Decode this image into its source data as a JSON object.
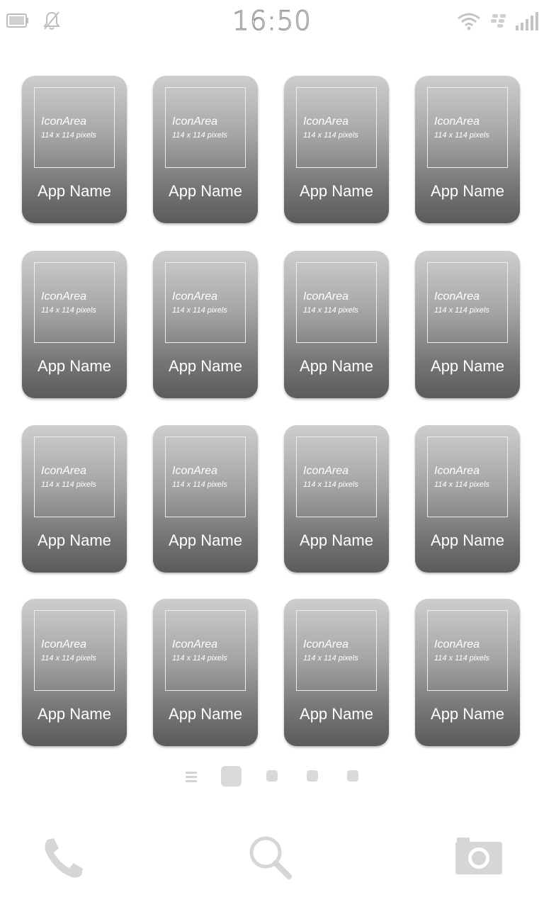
{
  "status_bar": {
    "time": "16:50",
    "icons": [
      "battery-icon",
      "notifications-off-icon",
      "wifi-icon",
      "bbm-icon",
      "signal-icon"
    ]
  },
  "apps": [
    {
      "icon_area_title": "IconArea",
      "icon_area_size": "114 x 114 pixels",
      "name": "App Name"
    },
    {
      "icon_area_title": "IconArea",
      "icon_area_size": "114 x 114 pixels",
      "name": "App Name"
    },
    {
      "icon_area_title": "IconArea",
      "icon_area_size": "114 x 114 pixels",
      "name": "App Name"
    },
    {
      "icon_area_title": "IconArea",
      "icon_area_size": "114 x 114 pixels",
      "name": "App Name"
    },
    {
      "icon_area_title": "IconArea",
      "icon_area_size": "114 x 114 pixels",
      "name": "App Name"
    },
    {
      "icon_area_title": "IconArea",
      "icon_area_size": "114 x 114 pixels",
      "name": "App Name"
    },
    {
      "icon_area_title": "IconArea",
      "icon_area_size": "114 x 114 pixels",
      "name": "App Name"
    },
    {
      "icon_area_title": "IconArea",
      "icon_area_size": "114 x 114 pixels",
      "name": "App Name"
    },
    {
      "icon_area_title": "IconArea",
      "icon_area_size": "114 x 114 pixels",
      "name": "App Name"
    },
    {
      "icon_area_title": "IconArea",
      "icon_area_size": "114 x 114 pixels",
      "name": "App Name"
    },
    {
      "icon_area_title": "IconArea",
      "icon_area_size": "114 x 114 pixels",
      "name": "App Name"
    },
    {
      "icon_area_title": "IconArea",
      "icon_area_size": "114 x 114 pixels",
      "name": "App Name"
    },
    {
      "icon_area_title": "IconArea",
      "icon_area_size": "114 x 114 pixels",
      "name": "App Name"
    },
    {
      "icon_area_title": "IconArea",
      "icon_area_size": "114 x 114 pixels",
      "name": "App Name"
    },
    {
      "icon_area_title": "IconArea",
      "icon_area_size": "114 x 114 pixels",
      "name": "App Name"
    },
    {
      "icon_area_title": "IconArea",
      "icon_area_size": "114 x 114 pixels",
      "name": "App Name"
    }
  ],
  "page_indicator": {
    "menu_icon": "list-menu-icon",
    "page_count": 4,
    "active_page": 1
  },
  "dock": {
    "icons": [
      "phone-icon",
      "search-icon",
      "camera-icon"
    ]
  },
  "colors": {
    "tile_top": "#cfcecc",
    "tile_bottom": "#5c5b5a",
    "chrome_icon": "#d6d6d6",
    "text_on_tile": "#ffffff"
  }
}
